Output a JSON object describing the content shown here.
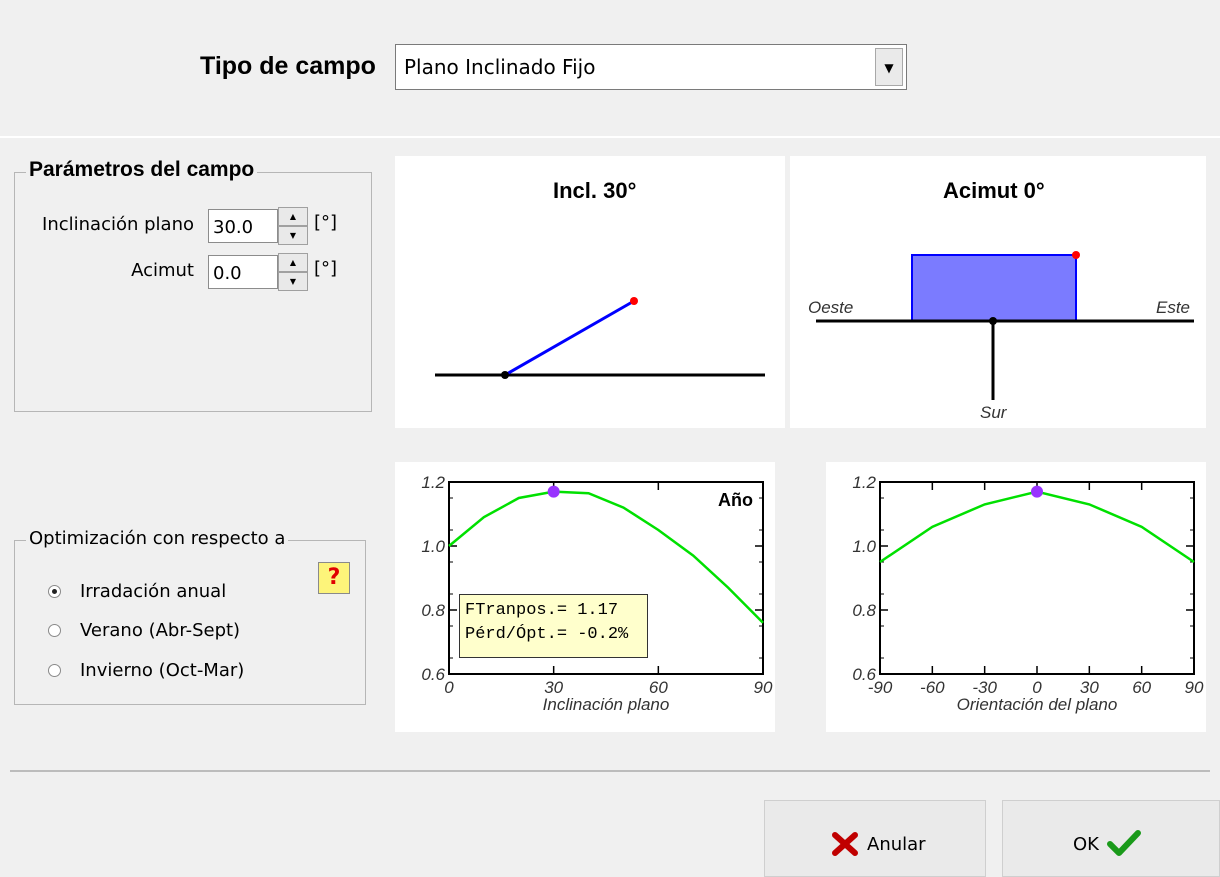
{
  "header": {
    "field_type_label": "Tipo de campo",
    "field_type_value": "Plano Inclinado Fijo"
  },
  "params": {
    "title": "Parámetros del campo",
    "tilt_label": "Inclinación plano",
    "tilt_value": "30.0",
    "tilt_unit": "[°]",
    "azimuth_label": "Acimut",
    "azimuth_value": "0.0",
    "azimuth_unit": "[°]"
  },
  "optimization": {
    "title": "Optimización con respecto a",
    "options": [
      "Irradación anual",
      "Verano (Abr-Sept)",
      "Invierno (Oct-Mar)"
    ],
    "selected": 0,
    "help_label": "?"
  },
  "diagrams": {
    "tilt_title": "Incl. 30°",
    "azimuth_title": "Acimut 0°",
    "west_label": "Oeste",
    "east_label": "Este",
    "south_label": "Sur",
    "colors": {
      "panel_fill": "#7b7bff",
      "line": "#0000ff",
      "marker": "#ff0000"
    }
  },
  "chart_data": [
    {
      "type": "line",
      "xlabel": "Inclinación plano",
      "x_ticks": [
        "0",
        "30",
        "60",
        "90"
      ],
      "y_ticks": [
        "0.6",
        "0.8",
        "1.0",
        "1.2"
      ],
      "xlim": [
        0,
        90
      ],
      "ylim": [
        0.6,
        1.2
      ],
      "legend": "Año",
      "x": [
        0,
        10,
        20,
        30,
        40,
        50,
        60,
        70,
        80,
        90
      ],
      "values": [
        1.0,
        1.09,
        1.15,
        1.17,
        1.165,
        1.12,
        1.05,
        0.97,
        0.87,
        0.76
      ],
      "marker": {
        "x": 30,
        "y": 1.17
      },
      "info_lines": [
        "FTranpos.= 1.17",
        "Pérd/Ópt.= -0.2%"
      ],
      "colors": {
        "curve": "#00e000",
        "marker": "#9933ff"
      }
    },
    {
      "type": "line",
      "xlabel": "Orientación del plano",
      "x_ticks": [
        "-90",
        "-60",
        "-30",
        "0",
        "30",
        "60",
        "90"
      ],
      "y_ticks": [
        "0.6",
        "0.8",
        "1.0",
        "1.2"
      ],
      "xlim": [
        -90,
        90
      ],
      "ylim": [
        0.6,
        1.2
      ],
      "x": [
        -90,
        -60,
        -30,
        0,
        30,
        60,
        90
      ],
      "values": [
        0.95,
        1.06,
        1.13,
        1.17,
        1.13,
        1.06,
        0.95
      ],
      "marker": {
        "x": 0,
        "y": 1.17
      },
      "colors": {
        "curve": "#00e000",
        "marker": "#9933ff"
      }
    }
  ],
  "footer": {
    "cancel_label": "Anular",
    "ok_label": "OK"
  }
}
